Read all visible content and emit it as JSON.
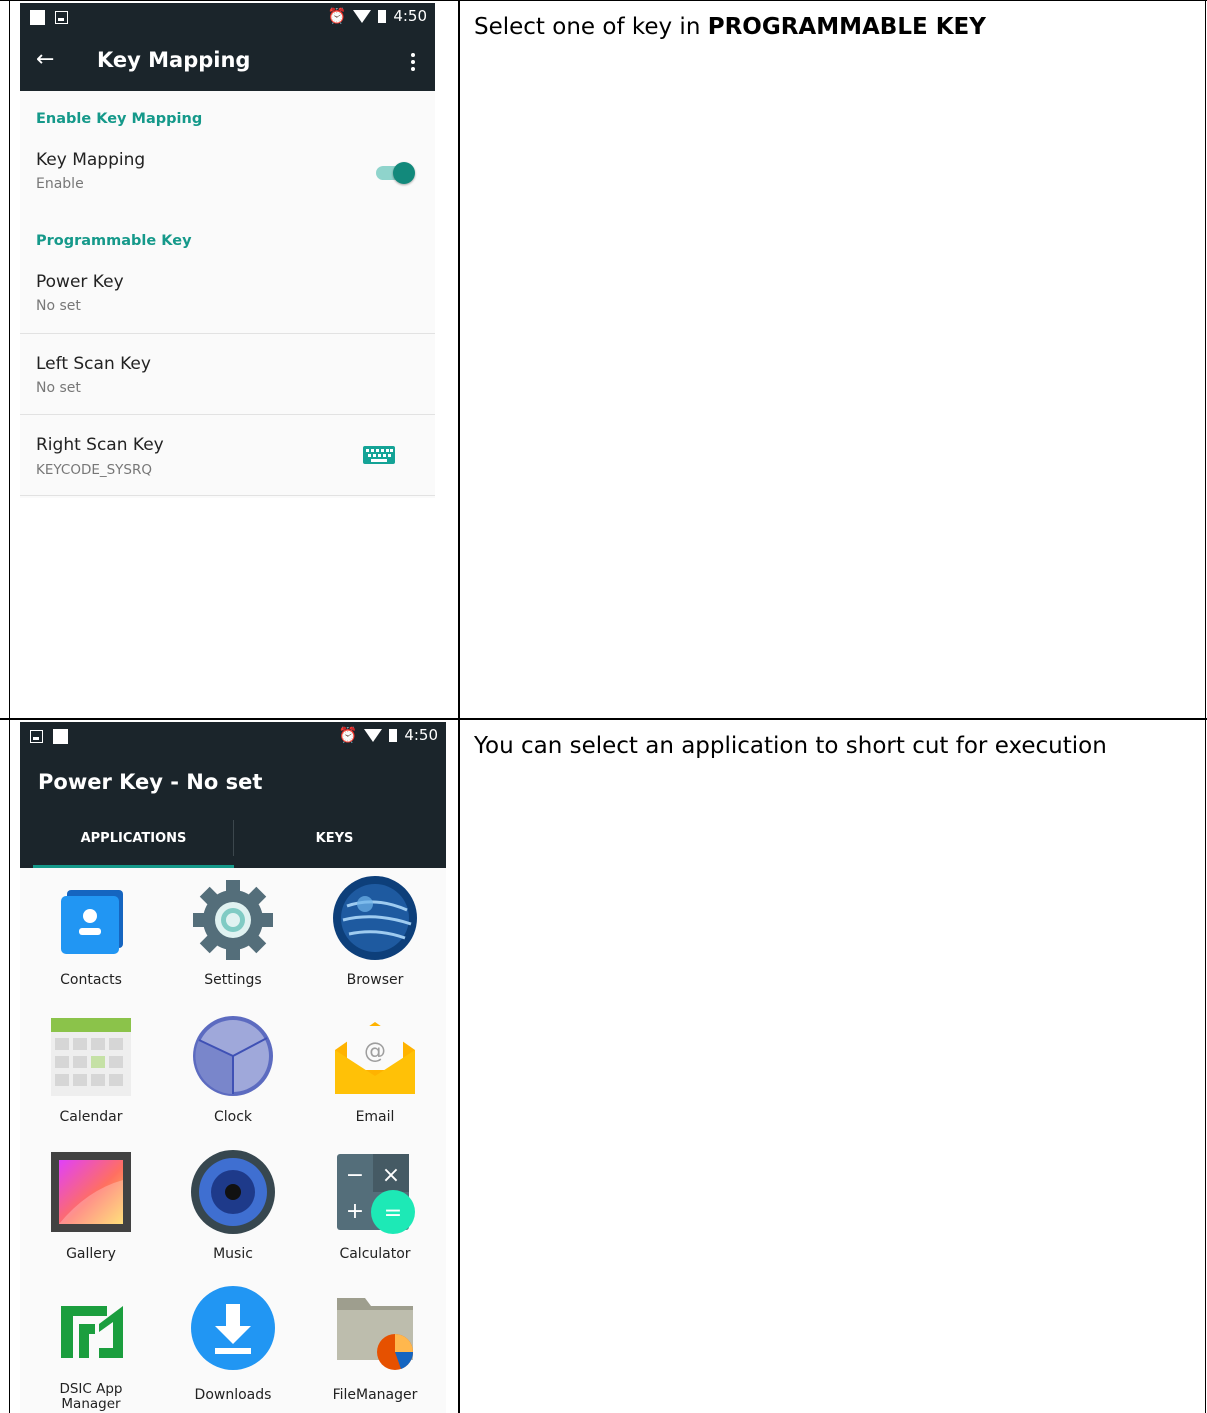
{
  "row1": {
    "instruction_prefix": "Select one of key in ",
    "instruction_bold": "PROGRAMMABLE KEY",
    "phone": {
      "status_time": "4:50",
      "toolbar_title": "Key Mapping",
      "section_enable": "Enable Key Mapping",
      "key_mapping_title": "Key Mapping",
      "key_mapping_summary": "Enable",
      "key_mapping_on": true,
      "section_programmable": "Programmable Key",
      "keys": [
        {
          "title": "Power Key",
          "summary": "No set"
        },
        {
          "title": "Left Scan Key",
          "summary": "No set"
        },
        {
          "title": "Right Scan Key",
          "summary": "KEYCODE_SYSRQ",
          "icon": "keyboard-icon"
        }
      ]
    }
  },
  "row2": {
    "instruction": "You can select an application to short cut for execution",
    "phone": {
      "status_time": "4:50",
      "title": "Power Key - No set",
      "tabs": [
        "APPLICATIONS",
        "KEYS"
      ],
      "selected_tab": "APPLICATIONS",
      "apps": [
        {
          "label": "Contacts",
          "icon": "contacts-icon"
        },
        {
          "label": "Settings",
          "icon": "settings-icon"
        },
        {
          "label": "Browser",
          "icon": "browser-icon"
        },
        {
          "label": "Calendar",
          "icon": "calendar-icon"
        },
        {
          "label": "Clock",
          "icon": "clock-icon"
        },
        {
          "label": "Email",
          "icon": "email-icon"
        },
        {
          "label": "Gallery",
          "icon": "gallery-icon"
        },
        {
          "label": "Music",
          "icon": "music-icon"
        },
        {
          "label": "Calculator",
          "icon": "calculator-icon"
        },
        {
          "label": "DSIC App\nManager",
          "icon": "dsic-app-manager-icon"
        },
        {
          "label": "Downloads",
          "icon": "downloads-icon"
        },
        {
          "label": "FileManager",
          "icon": "file-manager-icon"
        }
      ]
    }
  },
  "colors": {
    "bar": "#1b252b",
    "accent": "#15998a"
  }
}
